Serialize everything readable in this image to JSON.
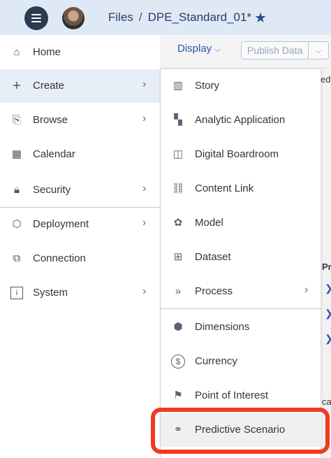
{
  "header": {
    "breadcrumb_root": "Files",
    "separator": "/",
    "document_title": "DPE_Standard_01*"
  },
  "toolbar": {
    "display_label": "Display",
    "publish_label": "Publish Data"
  },
  "background_fragments": {
    "edi": "edi",
    "pr": "Pr",
    "ca": "ca"
  },
  "nav": {
    "items": [
      {
        "label": "Home",
        "icon": "home-icon"
      },
      {
        "label": "Create",
        "icon": "plus-icon"
      },
      {
        "label": "Browse",
        "icon": "browse-icon"
      },
      {
        "label": "Calendar",
        "icon": "calendar-icon"
      },
      {
        "label": "Security",
        "icon": "lock-icon"
      },
      {
        "label": "Deployment",
        "icon": "deployment-icon"
      },
      {
        "label": "Connection",
        "icon": "connection-icon"
      },
      {
        "label": "System",
        "icon": "info-icon"
      }
    ]
  },
  "submenu": {
    "items": [
      {
        "label": "Story",
        "icon": "story-icon"
      },
      {
        "label": "Analytic Application",
        "icon": "analytic-application-icon"
      },
      {
        "label": "Digital Boardroom",
        "icon": "digital-boardroom-icon"
      },
      {
        "label": "Content Link",
        "icon": "link-icon"
      },
      {
        "label": "Model",
        "icon": "model-icon"
      },
      {
        "label": "Dataset",
        "icon": "dataset-icon"
      },
      {
        "label": "Process",
        "icon": "process-icon"
      },
      {
        "label": "Dimensions",
        "icon": "dimensions-icon"
      },
      {
        "label": "Currency",
        "icon": "currency-icon"
      },
      {
        "label": "Point of Interest",
        "icon": "flag-icon"
      },
      {
        "label": "Predictive Scenario",
        "icon": "binoculars-icon"
      }
    ]
  },
  "colors": {
    "header_bg": "#dfe9f6",
    "accent": "#2a5aa8",
    "highlight": "#f03a20"
  }
}
